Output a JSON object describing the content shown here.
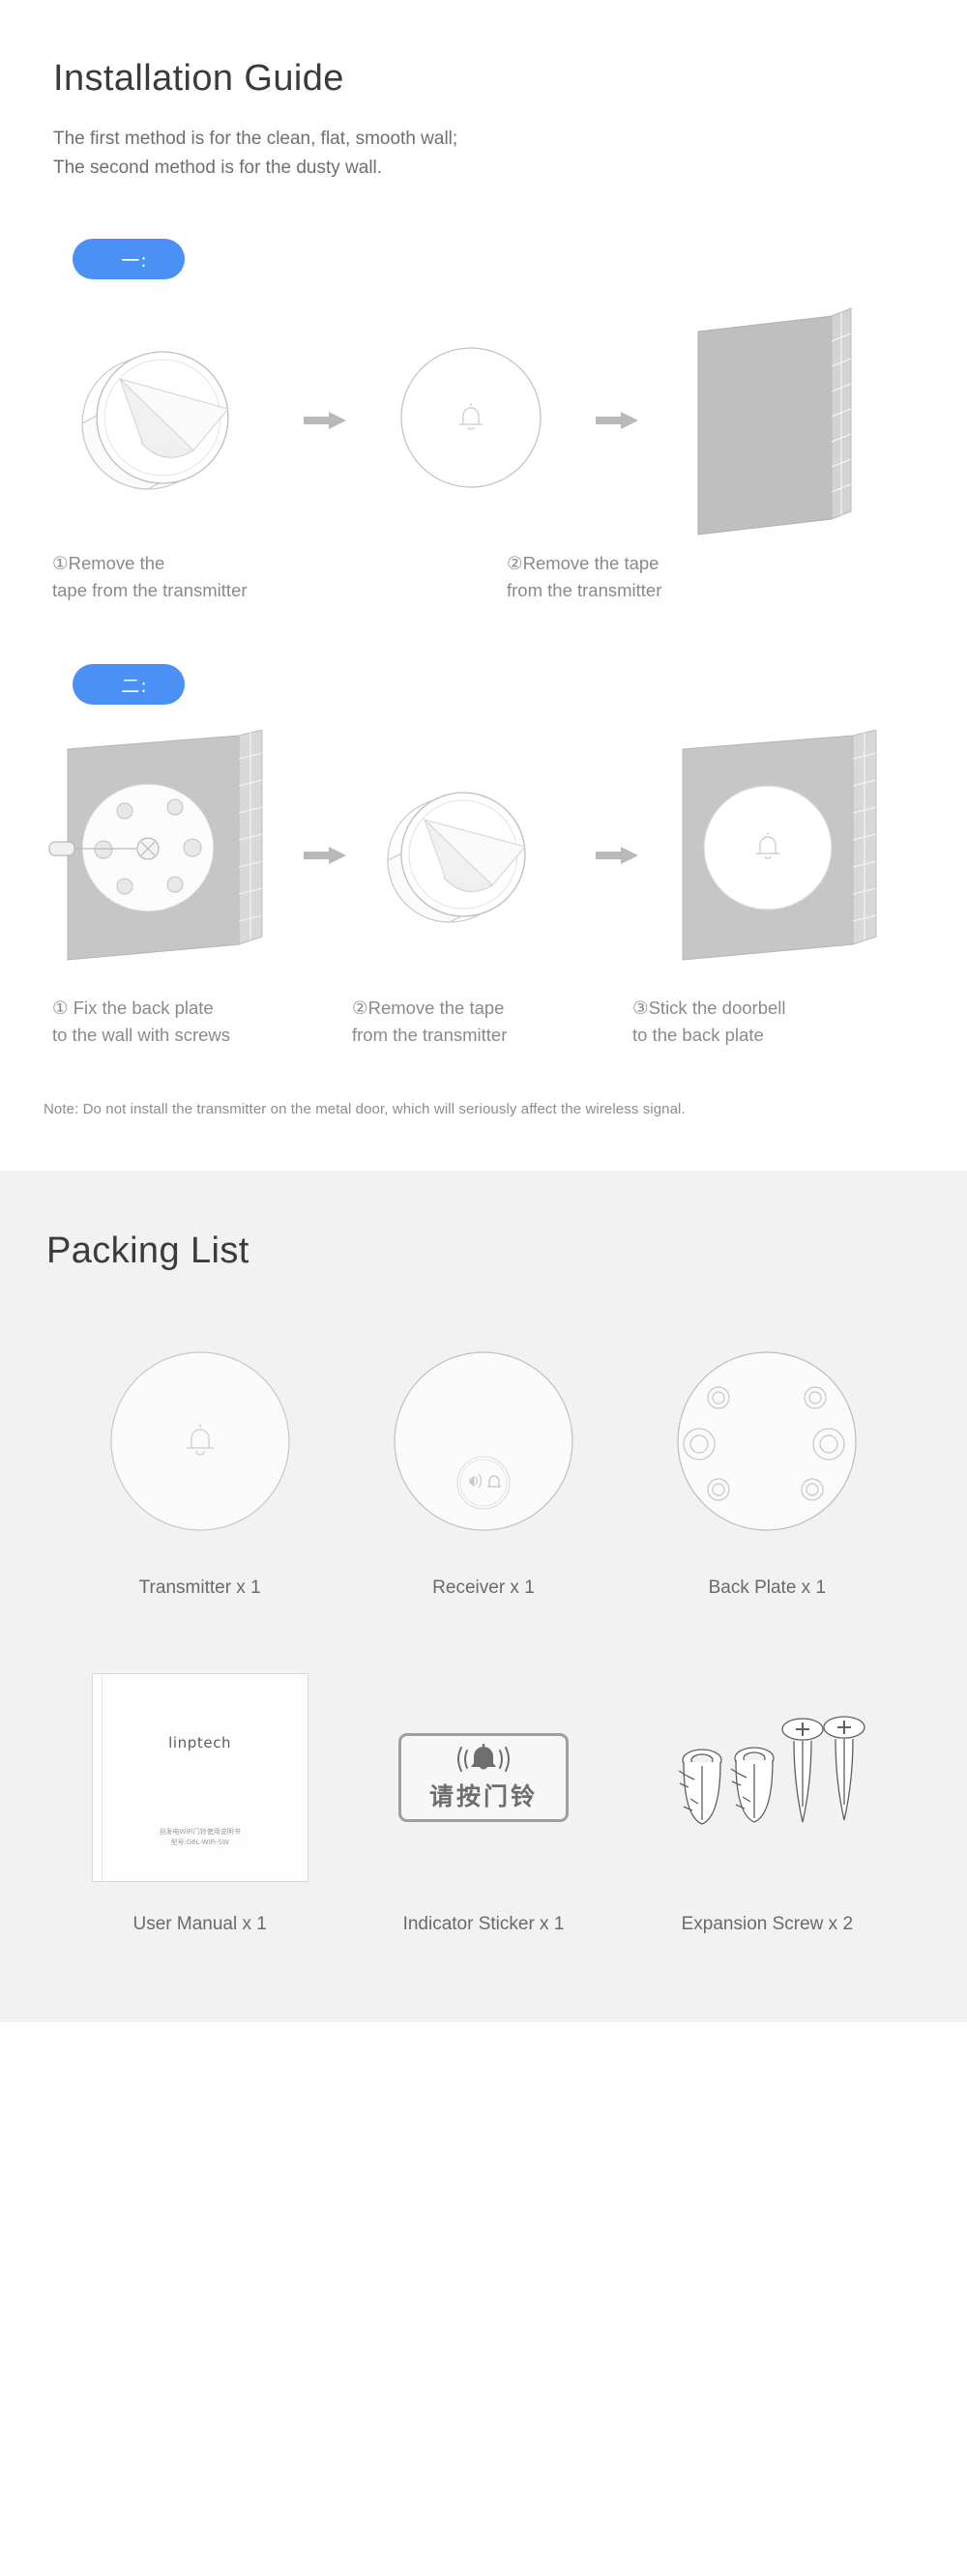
{
  "install": {
    "title": "Installation Guide",
    "subtitle_line1": "The first method is for the clean, flat, smooth wall;",
    "subtitle_line2": "The second method is for the dusty wall.",
    "badge_one": "一:",
    "badge_two": "二:",
    "method1": {
      "caption1": "①Remove the\n  tape from the transmitter",
      "caption2": "②Remove the tape\n  from the transmitter"
    },
    "method2": {
      "caption1": "① Fix the back plate\n   to the wall with screws",
      "caption2": "②Remove the tape\n  from the transmitter",
      "caption3": "③Stick the doorbell\n  to the back plate"
    },
    "note": "Note: Do not install the transmitter on the metal door, which will seriously affect the wireless signal."
  },
  "packing": {
    "title": "Packing List",
    "items_row1": [
      {
        "label": "Transmitter x 1",
        "icon": "doorbell-circle-icon"
      },
      {
        "label": "Receiver x 1",
        "icon": "receiver-circle-icon"
      },
      {
        "label": "Back Plate x 1",
        "icon": "back-plate-icon"
      }
    ],
    "items_row2": [
      {
        "label": "User Manual x 1",
        "icon": "manual-book-icon"
      },
      {
        "label": "Indicator Sticker x 1",
        "icon": "sticker-icon"
      },
      {
        "label": "Expansion Screw x 2",
        "icon": "screw-anchor-icon"
      }
    ],
    "manual": {
      "brand": "linptech",
      "cn_line1": "自发电WiFi门铃使用说明书",
      "cn_line2": "型号:G6L-WiFi-SW"
    },
    "sticker": {
      "text": "请按门铃",
      "icon": "ringing-bell-icon"
    }
  },
  "colors": {
    "badge_blue": "#4a90f5",
    "section_bg": "#f2f2f2",
    "title": "#3b3b3b",
    "body_text": "#6f6f6f",
    "caption": "#8a8a8a"
  }
}
